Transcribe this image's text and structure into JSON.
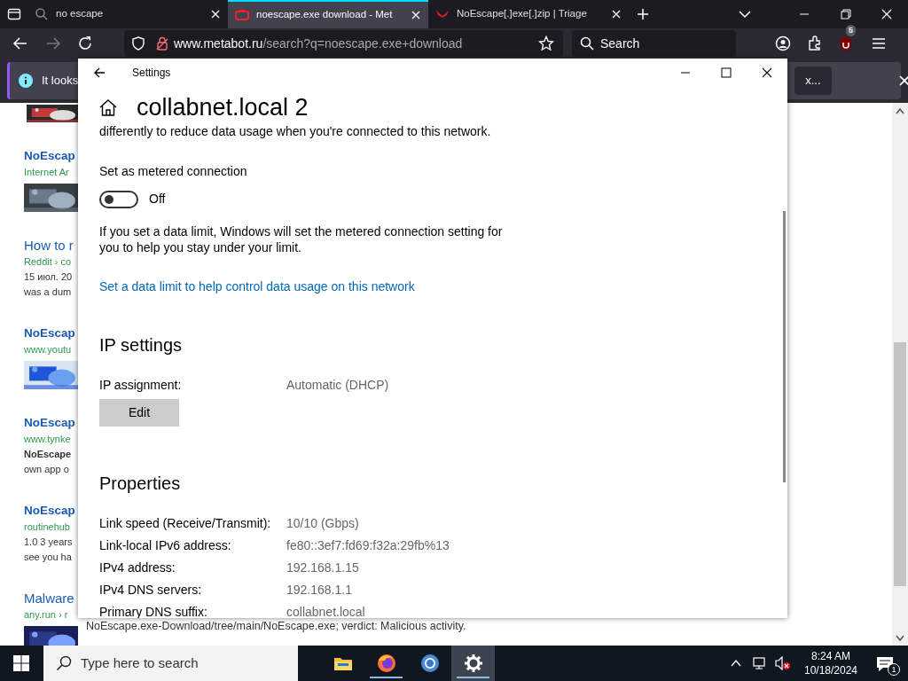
{
  "browser": {
    "tabs": [
      {
        "title": "no escape",
        "selected": false,
        "kind": "search"
      },
      {
        "title": "noescape.exe download - Met",
        "selected": true,
        "kind": "meta"
      },
      {
        "title": "NoEscape[.]exe[.]zip | Triage",
        "selected": false,
        "kind": "triage"
      }
    ],
    "url_host": "www.metabot.ru",
    "url_path": "/search?q=noescape.exe+download",
    "search_placeholder": "Search",
    "extension_badge": "5",
    "notification": {
      "text": "It looks",
      "button": "x..."
    }
  },
  "results": [
    {
      "kind": "image_only"
    },
    {
      "title": "NoEscap",
      "bold": true,
      "source": "Internet Ar"
    },
    {
      "title": "How to r",
      "bold": false,
      "source": "Reddit › co",
      "snippet": [
        "15 июл. 20",
        "was a dum"
      ],
      "kind": "text"
    },
    {
      "title": "NoEscap",
      "bold": true,
      "source": "www.youtu"
    },
    {
      "title": "NoEscap",
      "bold": true,
      "source": "www.tynke",
      "snippet": [
        "**NoEscape**",
        "own app o"
      ],
      "kind": "text"
    },
    {
      "title": "NoEscap",
      "bold": true,
      "source": "routinehub",
      "snippet": [
        "1.0 3 years",
        "see you ha"
      ],
      "kind": "text"
    },
    {
      "title": "Malware",
      "bold": false,
      "source": "any.run › r"
    }
  ],
  "footer_snippet": "NoEscape.exe-Download/tree/main/NoEscape.exe; verdict: Malicious activity.",
  "settings": {
    "title": "Settings",
    "heading": "collabnet.local 2",
    "intro": "differently to reduce data usage when you're connected to this network.",
    "metered": {
      "label": "Set as metered connection",
      "on": false,
      "state": "Off"
    },
    "info": "If you set a data limit, Windows will set the metered connection setting for you to help you stay under your limit.",
    "link": "Set a data limit to help control data usage on this network",
    "ip_section": "IP settings",
    "ip_rows": [
      {
        "label": "IP assignment:",
        "value": "Automatic (DHCP)"
      }
    ],
    "edit_button": "Edit",
    "properties_section": "Properties",
    "properties": [
      {
        "label": "Link speed (Receive/Transmit):",
        "value": "10/10 (Gbps)"
      },
      {
        "label": "Link-local IPv6 address:",
        "value": "fe80::3ef7:fd69:f32a:29fb%13"
      },
      {
        "label": "IPv4 address:",
        "value": "192.168.1.15"
      },
      {
        "label": "IPv4 DNS servers:",
        "value": "192.168.1.1"
      },
      {
        "label": "Primary DNS suffix:",
        "value": "collabnet.local"
      }
    ]
  },
  "taskbar": {
    "search_placeholder": "Type here to search",
    "apps": [
      {
        "kind": "explorer",
        "running": false,
        "selected": false
      },
      {
        "kind": "firefox",
        "running": true,
        "selected": false
      },
      {
        "kind": "chrome",
        "running": false,
        "selected": false
      },
      {
        "kind": "settings",
        "running": true,
        "selected": true
      }
    ],
    "time": "8:24 AM",
    "date": "10/18/2024",
    "notifications": "1"
  }
}
